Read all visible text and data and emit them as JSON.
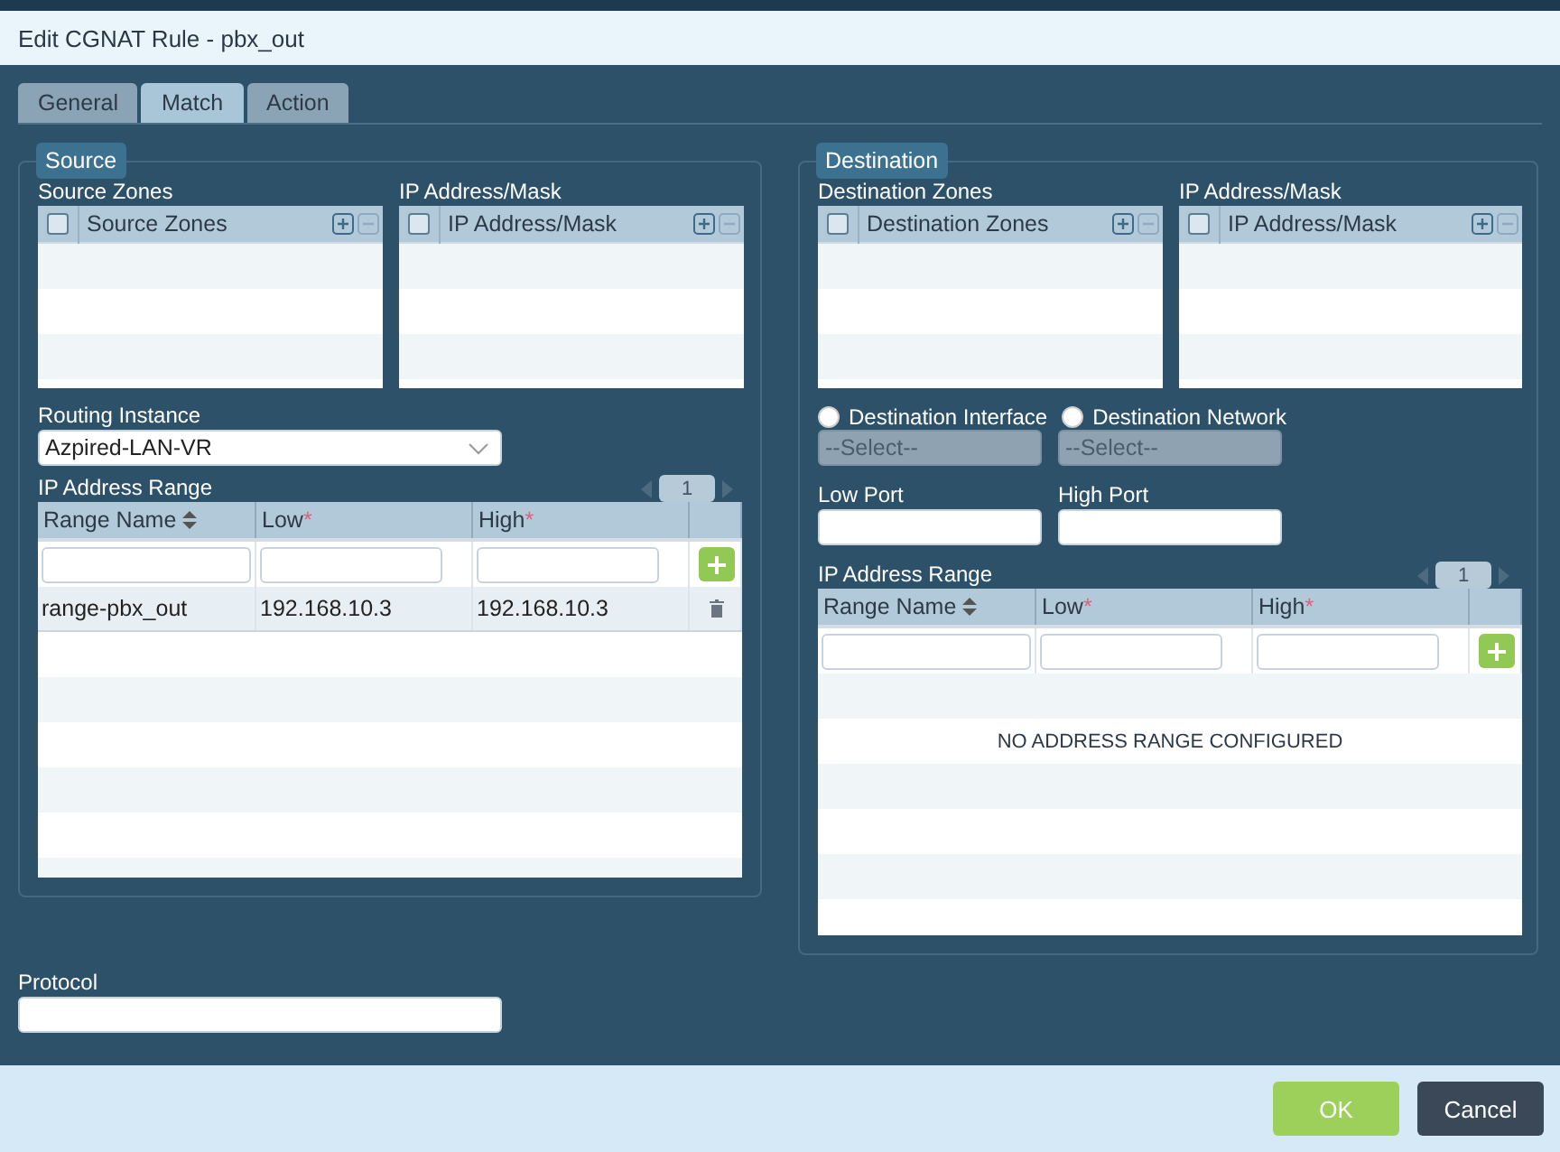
{
  "dialog": {
    "title": "Edit CGNAT Rule - pbx_out"
  },
  "tabs": [
    {
      "label": "General",
      "selected": false
    },
    {
      "label": "Match",
      "selected": true
    },
    {
      "label": "Action",
      "selected": false
    }
  ],
  "source": {
    "legend": "Source",
    "lists": [
      {
        "label": "Source Zones",
        "header": "Source Zones",
        "checked": false
      },
      {
        "label": "IP Address/Mask",
        "header": "IP Address/Mask",
        "checked": false
      }
    ],
    "routing_instance": {
      "label": "Routing Instance",
      "value": "Azpired-LAN-VR"
    },
    "range": {
      "label": "IP Address Range",
      "page": "1",
      "columns": [
        {
          "label": "Range Name",
          "sortable": true
        },
        {
          "label": "Low",
          "mark": "*"
        },
        {
          "label": "High",
          "mark": "*"
        }
      ],
      "rows": [
        [
          "range-pbx_out",
          "192.168.10.3",
          "192.168.10.3"
        ]
      ]
    }
  },
  "destination": {
    "legend": "Destination",
    "lists": [
      {
        "label": "Destination Zones",
        "header": "Destination Zones",
        "checked": false
      },
      {
        "label": "IP Address/Mask",
        "header": "IP Address/Mask",
        "checked": false
      }
    ],
    "radios": [
      {
        "label": "Destination Interface",
        "selected": false
      },
      {
        "label": "Destination Network",
        "selected": false
      }
    ],
    "selects": [
      {
        "placeholder": "--Select--",
        "disabled": true
      },
      {
        "placeholder": "--Select--",
        "disabled": true
      }
    ],
    "ports": [
      {
        "label": "Low Port"
      },
      {
        "label": "High Port"
      }
    ],
    "range": {
      "label": "IP Address Range",
      "page": "1",
      "columns": [
        {
          "label": "Range Name",
          "sortable": true
        },
        {
          "label": "Low",
          "mark": "*"
        },
        {
          "label": "High",
          "mark": "*"
        }
      ],
      "empty_message": "NO ADDRESS RANGE CONFIGURED"
    }
  },
  "protocol": {
    "label": "Protocol"
  },
  "buttons": [
    {
      "label": "OK",
      "kind": "primary"
    },
    {
      "label": "Cancel",
      "kind": "secondary"
    }
  ]
}
